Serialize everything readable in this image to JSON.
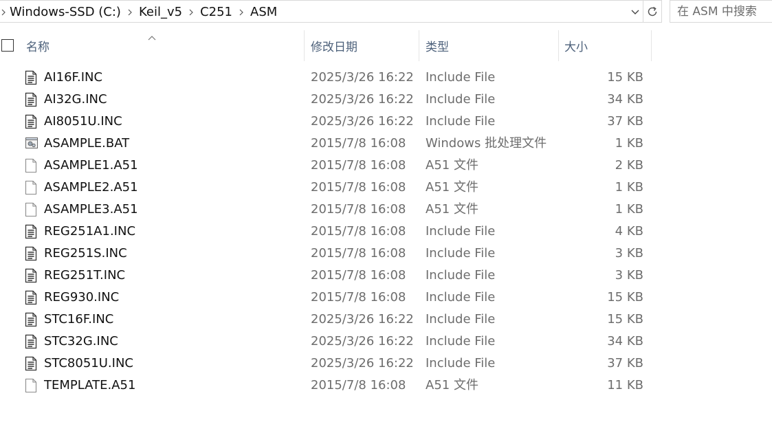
{
  "address": {
    "crumbs": [
      "Windows-SSD (C:)",
      "Keil_v5",
      "C251",
      "ASM"
    ]
  },
  "search": {
    "placeholder": "在 ASM 中搜索"
  },
  "columns": {
    "name": "名称",
    "date": "修改日期",
    "type": "类型",
    "size": "大小"
  },
  "files": [
    {
      "name": "AI16F.INC",
      "date": "2025/3/26 16:22",
      "type": "Include File",
      "size": "15 KB",
      "icon": "text-file-icon"
    },
    {
      "name": "AI32G.INC",
      "date": "2025/3/26 16:22",
      "type": "Include File",
      "size": "34 KB",
      "icon": "text-file-icon"
    },
    {
      "name": "AI8051U.INC",
      "date": "2025/3/26 16:22",
      "type": "Include File",
      "size": "37 KB",
      "icon": "text-file-icon"
    },
    {
      "name": "ASAMPLE.BAT",
      "date": "2015/7/8 16:08",
      "type": "Windows 批处理文件",
      "size": "1 KB",
      "icon": "batch-file-icon"
    },
    {
      "name": "ASAMPLE1.A51",
      "date": "2015/7/8 16:08",
      "type": "A51 文件",
      "size": "2 KB",
      "icon": "blank-file-icon"
    },
    {
      "name": "ASAMPLE2.A51",
      "date": "2015/7/8 16:08",
      "type": "A51 文件",
      "size": "1 KB",
      "icon": "blank-file-icon"
    },
    {
      "name": "ASAMPLE3.A51",
      "date": "2015/7/8 16:08",
      "type": "A51 文件",
      "size": "1 KB",
      "icon": "blank-file-icon"
    },
    {
      "name": "REG251A1.INC",
      "date": "2015/7/8 16:08",
      "type": "Include File",
      "size": "4 KB",
      "icon": "text-file-icon"
    },
    {
      "name": "REG251S.INC",
      "date": "2015/7/8 16:08",
      "type": "Include File",
      "size": "3 KB",
      "icon": "text-file-icon"
    },
    {
      "name": "REG251T.INC",
      "date": "2015/7/8 16:08",
      "type": "Include File",
      "size": "3 KB",
      "icon": "text-file-icon"
    },
    {
      "name": "REG930.INC",
      "date": "2015/7/8 16:08",
      "type": "Include File",
      "size": "15 KB",
      "icon": "text-file-icon"
    },
    {
      "name": "STC16F.INC",
      "date": "2025/3/26 16:22",
      "type": "Include File",
      "size": "15 KB",
      "icon": "text-file-icon"
    },
    {
      "name": "STC32G.INC",
      "date": "2025/3/26 16:22",
      "type": "Include File",
      "size": "34 KB",
      "icon": "text-file-icon"
    },
    {
      "name": "STC8051U.INC",
      "date": "2025/3/26 16:22",
      "type": "Include File",
      "size": "37 KB",
      "icon": "text-file-icon"
    },
    {
      "name": "TEMPLATE.A51",
      "date": "2015/7/8 16:08",
      "type": "A51 文件",
      "size": "11 KB",
      "icon": "blank-file-icon"
    }
  ]
}
